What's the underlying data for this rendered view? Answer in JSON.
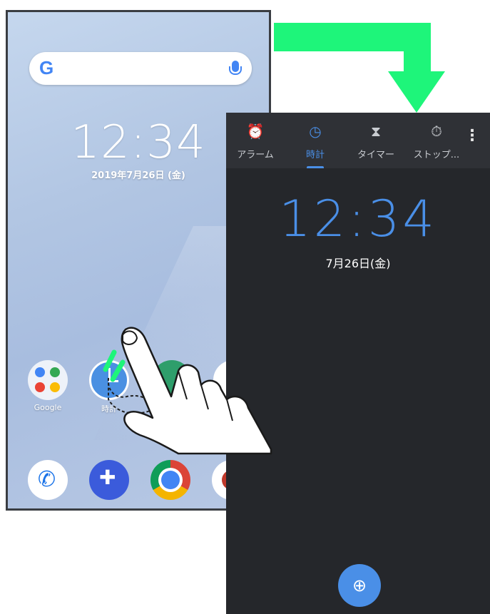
{
  "home": {
    "search": {
      "logo": "G",
      "mic_icon": "mic-icon"
    },
    "time": "12:34",
    "date": "2019年7月26日 (金)",
    "apps": [
      {
        "label": "Google"
      },
      {
        "label": "時計"
      }
    ],
    "dock": [
      {
        "icon": "phone-icon",
        "glyph": "✆"
      },
      {
        "icon": "softbank-message-icon",
        "glyph": "✚"
      },
      {
        "icon": "chrome-icon"
      },
      {
        "icon": "camera-icon"
      }
    ]
  },
  "clock_app": {
    "tabs": [
      {
        "label": "アラーム",
        "icon": "⏰",
        "active": false
      },
      {
        "label": "時計",
        "icon": "◷",
        "active": true
      },
      {
        "label": "タイマー",
        "icon": "⧗",
        "active": false
      },
      {
        "label": "ストップ...",
        "icon": "⏱",
        "active": false
      }
    ],
    "more_icon": "⋮",
    "time": "12:34",
    "date": "7月26日(金)",
    "fab_icon": "globe-icon",
    "fab_glyph": "⊕"
  },
  "colors": {
    "accent": "#4a8fe7",
    "arrow": "#1ef57a",
    "dark_bg": "#25272b",
    "tab_bg": "#2f3136"
  }
}
